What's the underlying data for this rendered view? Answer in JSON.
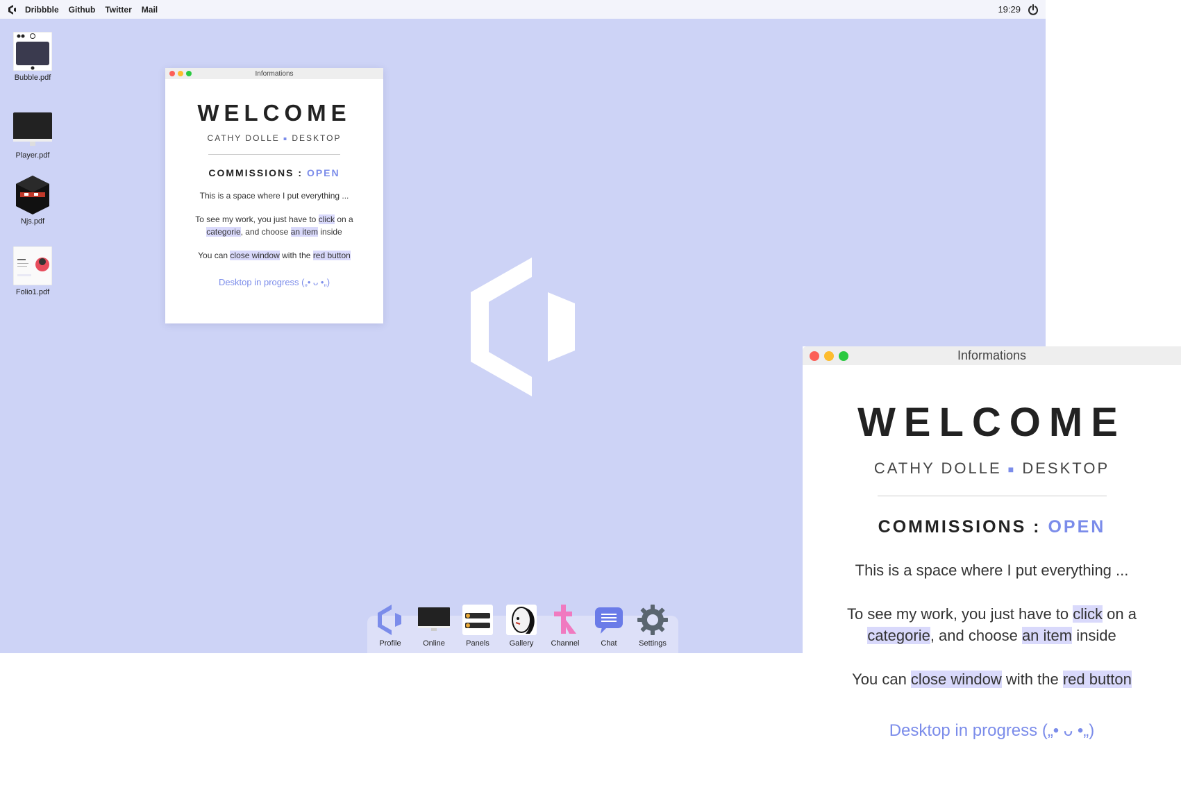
{
  "menubar": {
    "items": [
      "Dribbble",
      "Github",
      "Twitter",
      "Mail"
    ],
    "clock": "19:29"
  },
  "desktop_icons": [
    {
      "label": "Bubble.pdf"
    },
    {
      "label": "Player.pdf"
    },
    {
      "label": "Njs.pdf"
    },
    {
      "label": "Folio1.pdf"
    }
  ],
  "window": {
    "title": "Informations",
    "welcome": "WELCOME",
    "subtitle_left": "CATHY DOLLE",
    "subtitle_sep": "■",
    "subtitle_right": "DESKTOP",
    "commissions_label": "COMMISSIONS :",
    "commissions_status": "OPEN",
    "intro": "This is a space where I put everything ...",
    "p2": {
      "a": "To see my work, you just have to ",
      "click": "click",
      "b": " on a ",
      "categorie": "categorie",
      "c": ", and choose ",
      "item": "an item",
      "d": " inside"
    },
    "p3": {
      "a": "You can ",
      "close": "close window",
      "b": " with the ",
      "red": "red button"
    },
    "progress": "Desktop in progress („• ᴗ •„)"
  },
  "dock": {
    "items": [
      {
        "label": "Profile"
      },
      {
        "label": "Online"
      },
      {
        "label": "Panels"
      },
      {
        "label": "Gallery"
      },
      {
        "label": "Channel"
      },
      {
        "label": "Chat"
      },
      {
        "label": "Settings"
      }
    ]
  },
  "colors": {
    "desktop_bg": "#cdd3f6",
    "accent": "#7b8cea",
    "highlight": "#d9d9fb"
  }
}
